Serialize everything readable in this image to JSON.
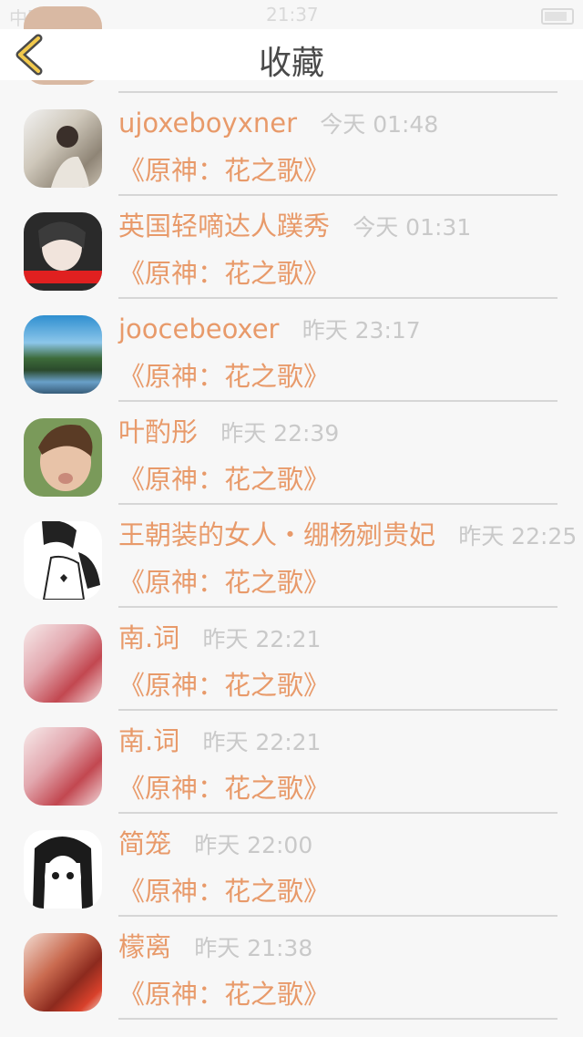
{
  "status_bar": {
    "carrier": "中国移动",
    "time": "21:37"
  },
  "header": {
    "title": "收藏"
  },
  "items": [
    {
      "name": "",
      "time": "",
      "book": "《原神：花之歌》"
    },
    {
      "name": "ujoxeboyxner",
      "time": "今天 01:48",
      "book": "《原神：花之歌》"
    },
    {
      "name": "英国轻嘀达人蹼秀",
      "time": "今天 01:31",
      "book": "《原神：花之歌》"
    },
    {
      "name": "joocebeoxer",
      "time": "昨天 23:17",
      "book": "《原神：花之歌》"
    },
    {
      "name": "叶酌彤",
      "time": "昨天 22:39",
      "book": "《原神：花之歌》"
    },
    {
      "name": "王朝装的女人・绷杨剜贵妃",
      "time": "昨天 22:25",
      "book": "《原神：花之歌》"
    },
    {
      "name": "南.词",
      "time": "昨天 22:21",
      "book": "《原神：花之歌》"
    },
    {
      "name": "南.词",
      "time": "昨天 22:21",
      "book": "《原神：花之歌》"
    },
    {
      "name": "简笼",
      "time": "昨天 22:00",
      "book": "《原神：花之歌》"
    },
    {
      "name": "檬离",
      "time": "昨天 21:38",
      "book": "《原神：花之歌》"
    }
  ]
}
